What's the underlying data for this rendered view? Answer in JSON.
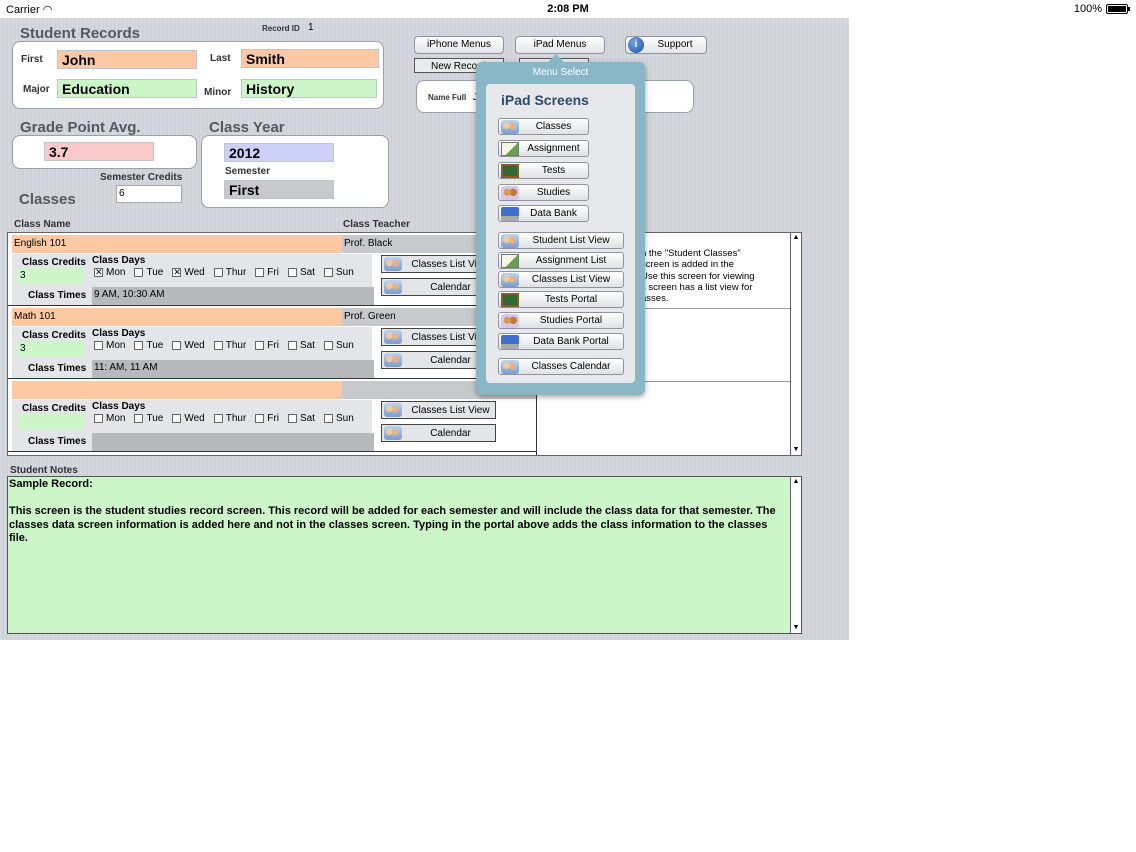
{
  "status_bar": {
    "carrier": "Carrier",
    "time": "2:08 PM",
    "battery": "100%"
  },
  "header": {
    "title": "Student Records",
    "record_id_label": "Record ID",
    "record_id_value": "1",
    "iphone_menus": "iPhone Menus",
    "ipad_menus": "iPad Menus",
    "support": "Support",
    "new_record": "New Record"
  },
  "name_panel": {
    "first_label": "First",
    "first_value": "John",
    "last_label": "Last",
    "last_value": "Smith",
    "major_label": "Major",
    "major_value": "Education",
    "minor_label": "Minor",
    "minor_value": "History"
  },
  "name_full_label": "Name Full",
  "gpa": {
    "title": "Grade Point Avg.",
    "value": "3.7"
  },
  "class_year": {
    "title": "Class Year",
    "year": "2012",
    "semester_label": "Semester",
    "semester_value": "First"
  },
  "semester_credits": {
    "label": "Semester Credits",
    "value": "6"
  },
  "classes": {
    "title": "Classes",
    "col_name": "Class Name",
    "col_teacher": "Class Teacher",
    "credits_label": "Class Credits",
    "days_label": "Class Days",
    "times_label": "Class Times",
    "list_view_btn": "Classes List View",
    "calendar_btn": "Calendar",
    "day_names": [
      "Mon",
      "Tue",
      "Wed",
      "Thur",
      "Fri",
      "Sat",
      "Sun"
    ],
    "rows": [
      {
        "name": "English 101",
        "teacher": "Prof. Black",
        "credits": "3",
        "times": "9 AM, 10:30 AM",
        "days_checked": [
          "Mon",
          "Wed"
        ]
      },
      {
        "name": "Math 101",
        "teacher": "Prof. Green",
        "credits": "3",
        "times": "11: AM, 11 AM",
        "days_checked": []
      },
      {
        "name": "",
        "teacher": "",
        "credits": "",
        "times": "",
        "days_checked": []
      }
    ],
    "side_text_lines": [
      "h the \"Student Classes\"",
      "screen is added in the",
      "Use this screen for viewing",
      "s screen has a list view for",
      "asses."
    ]
  },
  "notes": {
    "label": "Student Notes",
    "text": "Sample Record:\n\nThis screen is the student studies record screen. This record will be added for each semester and will include the class data for that semester. The classes data screen information is added here and not in the classes screen. Typing in the portal above adds the class information to the classes file."
  },
  "popover": {
    "title": "Menu Select",
    "heading": "iPad Screens",
    "group1": [
      {
        "label": "Classes",
        "icon": "people-icon"
      },
      {
        "label": "Assignment",
        "icon": "checklist-icon"
      },
      {
        "label": "Tests",
        "icon": "chalkboard-icon"
      },
      {
        "label": "Studies",
        "icon": "study-group-icon"
      },
      {
        "label": "Data Bank",
        "icon": "laptop-icon"
      }
    ],
    "group2": [
      {
        "label": "Student List View",
        "icon": "people-icon"
      },
      {
        "label": "Assignment List",
        "icon": "checklist-icon"
      },
      {
        "label": "Classes List View",
        "icon": "people-icon"
      },
      {
        "label": "Tests Portal",
        "icon": "chalkboard-icon"
      },
      {
        "label": "Studies Portal",
        "icon": "study-group-icon"
      },
      {
        "label": "Data Bank Portal",
        "icon": "laptop-icon"
      },
      {
        "label": "Classes Calendar",
        "icon": "people-icon"
      }
    ]
  }
}
